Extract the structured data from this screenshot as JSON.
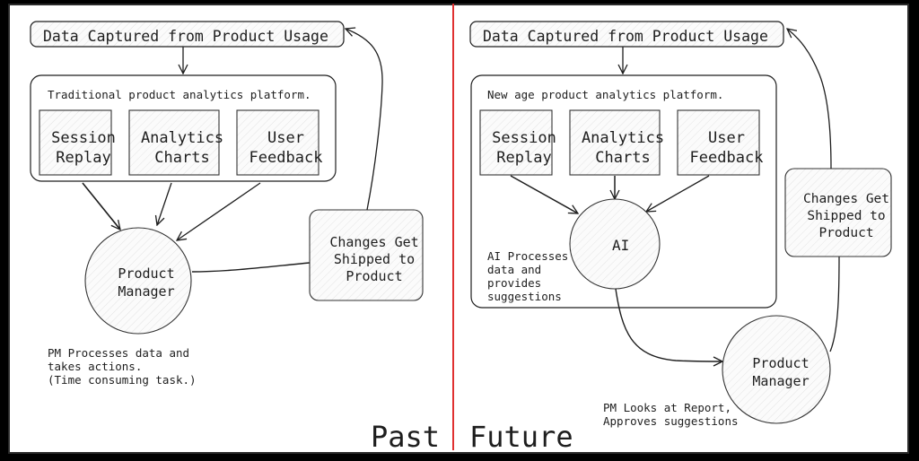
{
  "divider_color": "#e03131",
  "past": {
    "label": "Past",
    "source_box": "Data Captured from Product Usage",
    "platform_label": "Traditional product analytics platform.",
    "tools": [
      {
        "line1": "Session",
        "line2": "Replay"
      },
      {
        "line1": "Analytics",
        "line2": "Charts"
      },
      {
        "line1": "User",
        "line2": "Feedback"
      }
    ],
    "pm_node": {
      "line1": "Product",
      "line2": "Manager"
    },
    "ship_box": {
      "line1": "Changes Get",
      "line2": "Shipped to",
      "line3": "Product"
    },
    "note": {
      "line1": "PM Processes data and",
      "line2": "takes actions.",
      "line3": "(Time consuming task.)"
    }
  },
  "future": {
    "label": "Future",
    "source_box": "Data Captured from Product Usage",
    "platform_label": "New age product analytics platform.",
    "tools": [
      {
        "line1": "Session",
        "line2": "Replay"
      },
      {
        "line1": "Analytics",
        "line2": "Charts"
      },
      {
        "line1": "User",
        "line2": "Feedback"
      }
    ],
    "ai_node": "AI",
    "ai_note": {
      "line1": "AI Processes",
      "line2": "data and",
      "line3": "provides",
      "line4": "suggestions"
    },
    "pm_node": {
      "line1": "Product",
      "line2": "Manager"
    },
    "ship_box": {
      "line1": "Changes Get",
      "line2": "Shipped to",
      "line3": "Product"
    },
    "note": {
      "line1": "PM Looks at Report,",
      "line2": "Approves suggestions"
    }
  }
}
